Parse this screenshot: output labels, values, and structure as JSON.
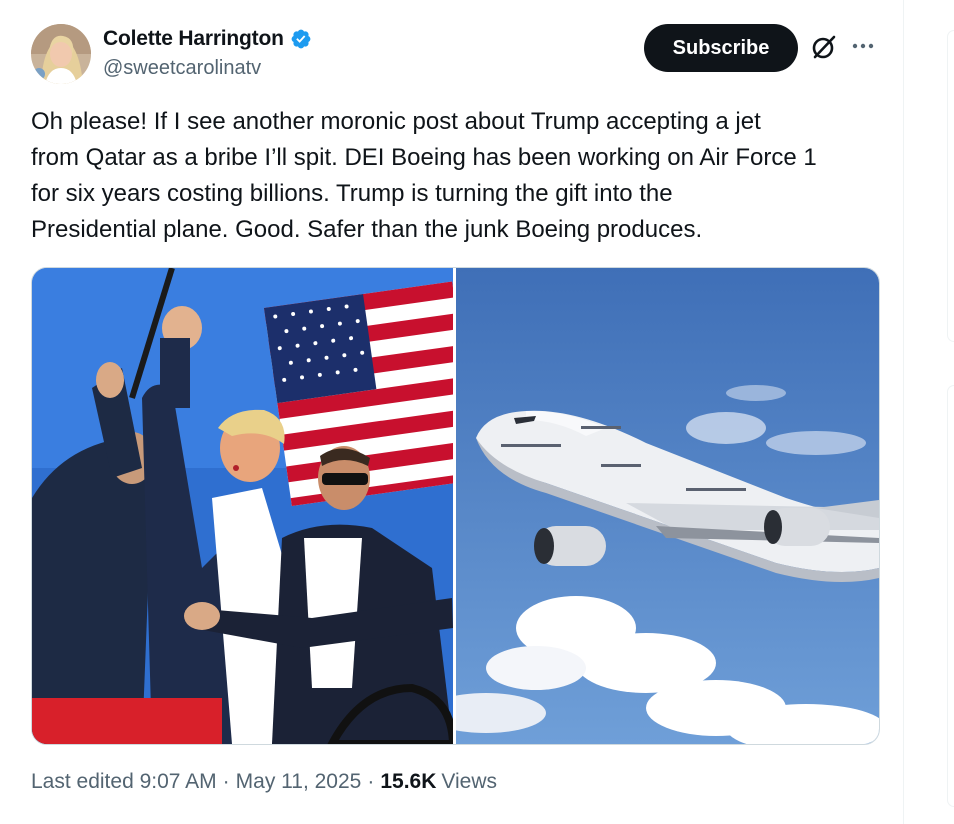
{
  "author": {
    "name": "Colette Harrington",
    "handle": "@sweetcarolinatv",
    "verified": true
  },
  "actions": {
    "subscribe_label": "Subscribe",
    "grok_icon": "grok-icon",
    "more_icon": "more-icon"
  },
  "post": {
    "lines": [
      "Oh please! If I see another moronic post about Trump accepting a jet",
      "from Qatar as a bribe I’ll spit. DEI Boeing has been working on Air Force 1",
      "for six years costing  billions. Trump is turning the gift into the",
      "Presidential plane. Good. Safer than the junk Boeing produces."
    ]
  },
  "media": {
    "left_photo": "rally photo with raised fist and american flag",
    "right_photo": "white jumbo jet in blue sky"
  },
  "meta": {
    "edited_label": "Last edited 9:07 AM",
    "date": "May 11, 2025",
    "separator": "·",
    "views_count": "15.6K",
    "views_label": "Views"
  },
  "colors": {
    "text": "#0f1419",
    "secondary": "#536471",
    "verified": "#1d9bf0",
    "button_bg": "#0f1419"
  }
}
